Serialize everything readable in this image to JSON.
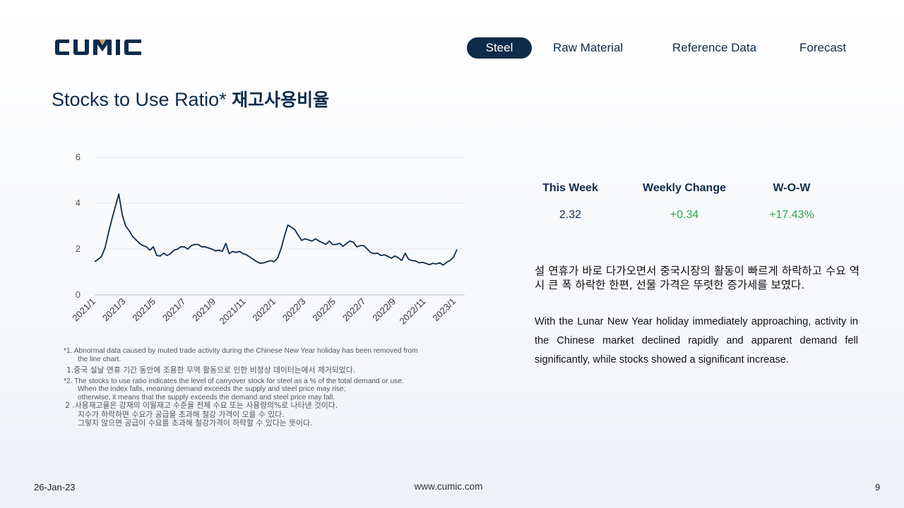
{
  "brand": {
    "logo_text": "CUMIC",
    "logo_color": "#0d2b4a",
    "accent_color": "#c9a06a"
  },
  "nav": {
    "items": [
      {
        "label": "Steel",
        "active": true
      },
      {
        "label": "Raw Material",
        "active": false
      },
      {
        "label": "Reference Data",
        "active": false
      },
      {
        "label": "Forecast",
        "active": false
      }
    ]
  },
  "page": {
    "title_en": "Stocks to Use Ratio*",
    "title_ko": "재고사용비율"
  },
  "stats": {
    "this_week_label": "This Week",
    "weekly_change_label": "Weekly Change",
    "wow_label": "W-O-W",
    "this_week_value": "2.32",
    "weekly_change_value": "+0.34",
    "wow_value": "+17.43%"
  },
  "description": {
    "ko": "설 연휴가 바로 다가오면서 중국시장의 활동이 빠르게 하락하고 수요 역시 큰 폭 하락한 한편, 선물 가격은 뚜렷한 증가세를 보였다.",
    "en": "With the Lunar New Year holiday immediately approaching, activity in the Chinese market declined rapidly and apparent demand fell significantly, while stocks showed a significant increase."
  },
  "notes": {
    "n1_en_a": "*1. Abnormal data caused by muted trade activity during the Chinese New Year holiday has been removed from",
    "n1_en_b": "the line chart.",
    "n1_ko": "1.중국 설날 연휴 기간 동안에 조용한 무역 활동으로 인한 비정상 데이터는에서 제거되었다.",
    "n2_en_a": "*2. The stocks to use ratio indicates the level of carryover stock for steel as a % of the total demand or use.",
    "n2_en_b": "When the index falls, meaning demand exceeds the supply and steel price may rise;",
    "n2_en_c": "otherwise, it means that the supply exceeds the demand and steel price may fall.",
    "n2_ko_a": "2 .사용재고율은 강재의 이월재고 수준을 전체 수요 또는 사용량의%로 나타낸 것이다.",
    "n2_ko_b": "지수가 하락하면 수요가 공급을 초과해 철강 가격이 오를 수 있다.",
    "n2_ko_c": "그렇지 않으면 공급이 수요를 초과해 철강가격이 하락할 수 있다는 뜻이다."
  },
  "footer": {
    "date": "26-Jan-23",
    "url": "www.cumic.com",
    "page": "9"
  },
  "chart_data": {
    "type": "line",
    "title": "",
    "xlabel": "",
    "ylabel": "",
    "ylim": [
      0,
      6
    ],
    "y_ticks": [
      0,
      2,
      4,
      6
    ],
    "x_tick_labels": [
      "2021/1",
      "2021/3",
      "2021/5",
      "2021/7",
      "2021/9",
      "2021/11",
      "2022/1",
      "2022/3",
      "2022/5",
      "2022/7",
      "2022/9",
      "2022/11",
      "2023/1"
    ],
    "grid": true,
    "line_color": "#0d2b4a",
    "series": [
      {
        "values": [
          1.45,
          1.55,
          1.68,
          2.05,
          2.7,
          3.3,
          3.85,
          4.4,
          3.5,
          3.0,
          2.8,
          2.55,
          2.4,
          2.25,
          2.15,
          2.1,
          1.95,
          2.1,
          1.72,
          1.7,
          1.82,
          1.72,
          1.8,
          1.95,
          2.0,
          2.1,
          2.1,
          2.0,
          2.15,
          2.2,
          2.2,
          2.1,
          2.1,
          2.05,
          2.0,
          1.92,
          1.95,
          1.9,
          2.25,
          1.8,
          1.9,
          1.85,
          1.9,
          1.8,
          1.75,
          1.65,
          1.55,
          1.45,
          1.38,
          1.4,
          1.45,
          1.5,
          1.45,
          1.6,
          2.0,
          2.55,
          3.05,
          2.95,
          2.85,
          2.6,
          2.38,
          2.45,
          2.4,
          2.35,
          2.45,
          2.35,
          2.28,
          2.2,
          2.35,
          2.2,
          2.2,
          2.25,
          2.12,
          2.25,
          2.35,
          2.3,
          2.1,
          2.15,
          2.15,
          2.0,
          1.85,
          1.8,
          1.82,
          1.72,
          1.75,
          1.68,
          1.6,
          1.7,
          1.62,
          1.5,
          1.82,
          1.55,
          1.5,
          1.48,
          1.4,
          1.42,
          1.38,
          1.32,
          1.38,
          1.35,
          1.4,
          1.3,
          1.42,
          1.5,
          1.65,
          1.98
        ]
      }
    ]
  }
}
